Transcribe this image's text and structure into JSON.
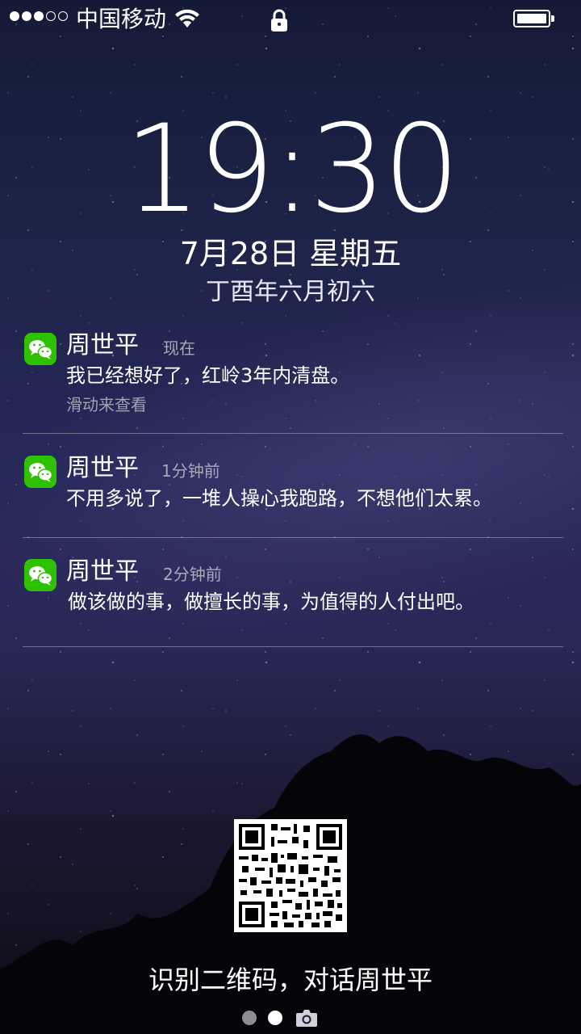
{
  "status_bar": {
    "signal_dots_filled": 3,
    "signal_dots_total": 5,
    "carrier": "中国移动",
    "battery_level": 1.0
  },
  "lockscreen": {
    "time": "19:30",
    "date": "7月28日   星期五",
    "lunar_date": "丁酉年六月初六"
  },
  "notifications": [
    {
      "app_icon": "wechat-icon",
      "sender": "周世平",
      "time": "现在",
      "message": "我已经想好了，红岭3年内清盘。",
      "hint": "滑动来查看"
    },
    {
      "app_icon": "wechat-icon",
      "sender": "周世平",
      "time": "1分钟前",
      "message": "不用多说了，一堆人操心我跑路，不想他们太累。"
    },
    {
      "app_icon": "wechat-icon",
      "sender": "周世平",
      "time": "2分钟前",
      "message": "做该做的事，做擅长的事，为值得的人付出吧。"
    }
  ],
  "qr_caption": "识别二维码，对话周世平",
  "pager": {
    "pages": 2,
    "current_page": 2,
    "camera_icon": "camera-icon"
  },
  "colors": {
    "wechat_green": "#2dc100",
    "text": "#ffffff",
    "muted_text": "#a9a9b8"
  }
}
